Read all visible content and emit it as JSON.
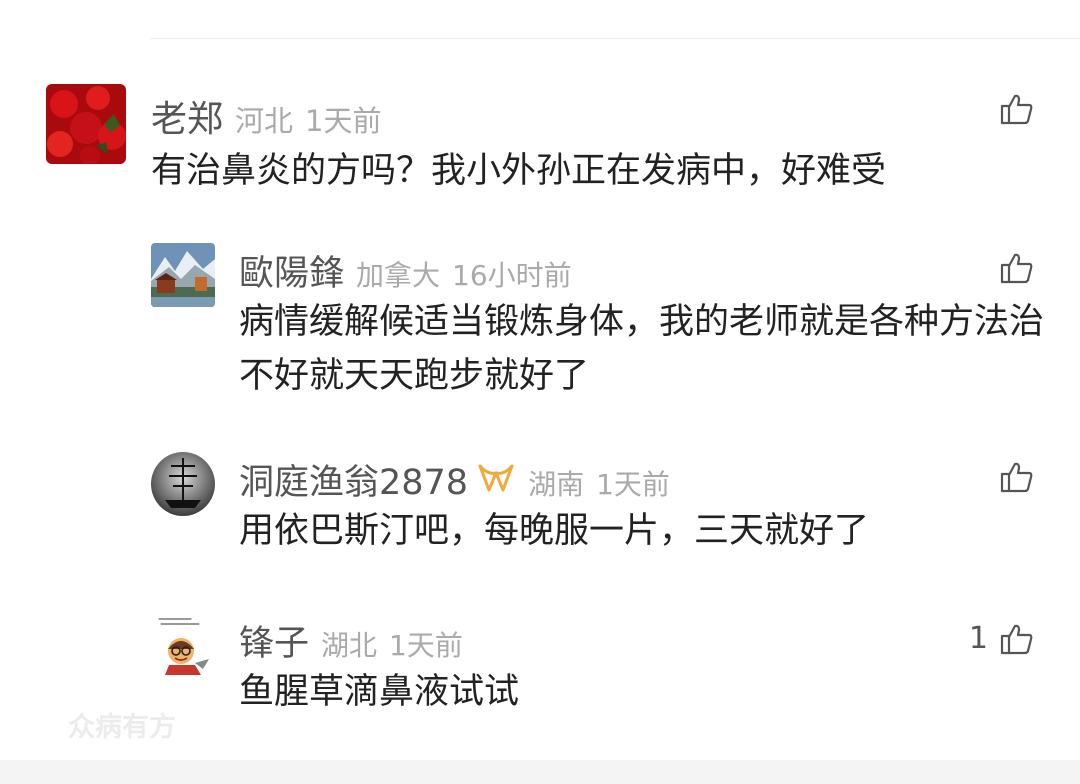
{
  "comments": [
    {
      "author": "老郑",
      "location": "河北",
      "time": "1天前",
      "text": "有治鼻炎的方吗？我小外孙正在发病中，好难受",
      "likes": ""
    }
  ],
  "replies": [
    {
      "author": "歐陽鋒",
      "location": "加拿大",
      "time": "16小时前",
      "text": "病情缓解候适当锻炼身体，我的老师就是各种方法治不好就天天跑步就好了",
      "likes": ""
    },
    {
      "author": "洞庭渔翁2878",
      "location": "湖南",
      "time": "1天前",
      "text": "用依巴斯汀吧，每晚服一片，三天就好了",
      "likes": ""
    },
    {
      "author": "锋子",
      "location": "湖北",
      "time": "1天前",
      "text": "鱼腥草滴鼻液试试",
      "likes": "1"
    }
  ],
  "watermark": "众病有方",
  "colors": {
    "name": "#555555",
    "meta": "#aaaaaa",
    "text": "#222222",
    "badge": "#f2a93b"
  }
}
